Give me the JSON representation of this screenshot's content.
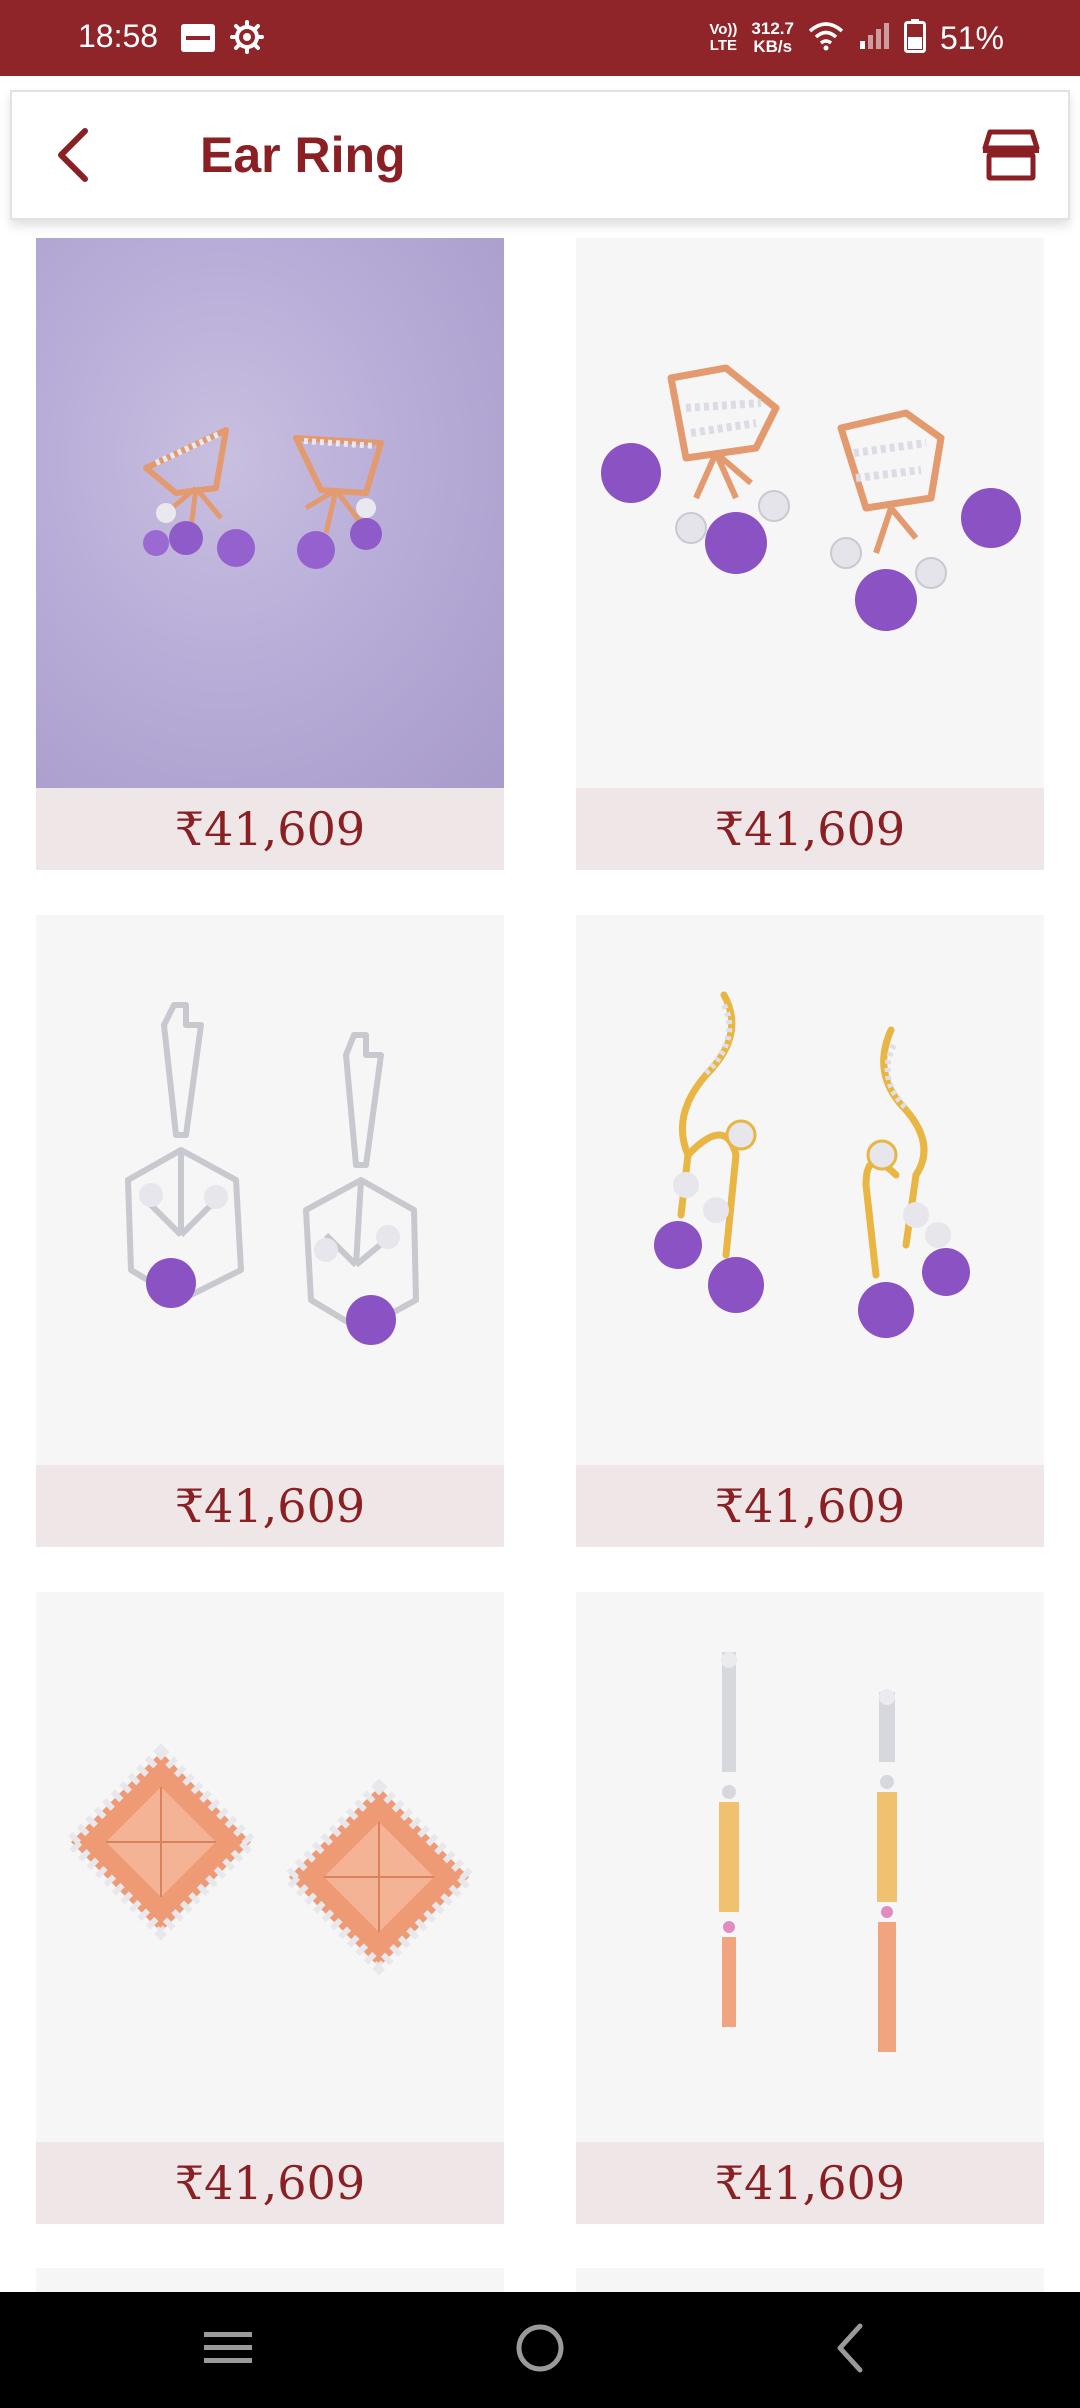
{
  "status_bar": {
    "time": "18:58",
    "network_type_top": "Vo))",
    "network_type_bottom": "LTE",
    "net_speed_value": "312.7",
    "net_speed_unit": "KB/s",
    "battery_percent": "51%",
    "battery_level": 0.51
  },
  "app_bar": {
    "title": "Ear Ring",
    "accent_color": "#8a1f24",
    "icons": {
      "back": "chevron-left-icon",
      "store": "store-icon"
    }
  },
  "products": [
    {
      "price": "₹41,609",
      "image": "rose-gold triangle earrings with amethyst drops on lilac background"
    },
    {
      "price": "₹41,609",
      "image": "rose-gold hexagon earrings with amethyst beads"
    },
    {
      "price": "₹41,609",
      "image": "white-gold hexagon drop earrings with amethyst"
    },
    {
      "price": "₹41,609",
      "image": "yellow-gold swirl earrings with amethyst drops"
    },
    {
      "price": "₹41,609",
      "image": "rose-gold diamond-shaped pyramid studs"
    },
    {
      "price": "₹41,609",
      "image": "two-tone bar drop earrings"
    }
  ],
  "nav_bar": {
    "icons": [
      "menu-icon",
      "home-icon",
      "back-icon"
    ]
  }
}
